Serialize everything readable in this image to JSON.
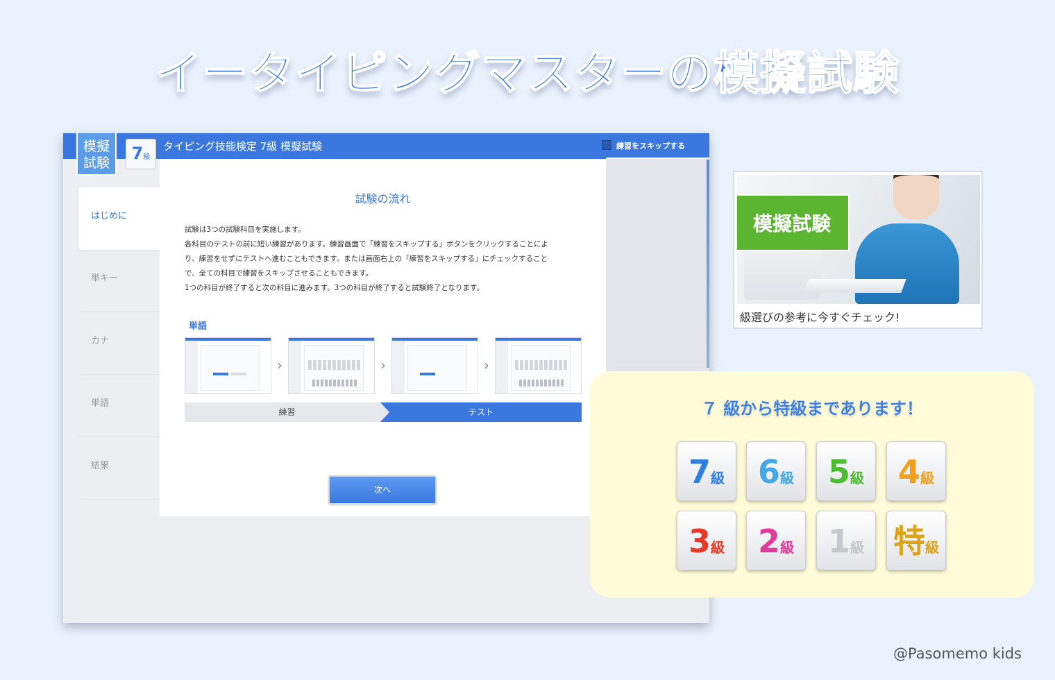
{
  "headline": "イータイピングマスターの模擬試験",
  "app": {
    "mode_badge": "模擬試験",
    "level_badge_num": "7",
    "level_badge_kyu": "級",
    "title": "タイピング技能検定 7級 模擬試験",
    "skip_label": "練習をスキップする",
    "sidebar": [
      "はじめに",
      "単キー",
      "カナ",
      "単語",
      "結果"
    ],
    "panel_title": "試験の流れ",
    "description": [
      "試験は3つの試験科目を実施します。",
      "各科目のテストの前に短い練習があります。練習画面で「練習をスキップする」ボタンをクリックすることによ",
      "り、練習をせずにテストへ進むこともできます。または画面右上の「練習をスキップする」にチェックすること",
      "で、全ての科目で練習をスキップさせることもできます。",
      "1つの科目が終了すると次の科目に進みます。3つの科目が終了すると試験終了となります。"
    ],
    "section_label": "単語",
    "chevron": "›",
    "flow_steps": [
      "練習",
      "テスト"
    ],
    "next_button": "次へ"
  },
  "promo": {
    "tag": "模擬試験",
    "caption": "級選びの参考に今すぐチェック!"
  },
  "levels": {
    "title": "７ 級から特級まであります！",
    "kyu_char": "級",
    "items": [
      {
        "num": "7",
        "color": "#2f7fe0"
      },
      {
        "num": "6",
        "color": "#45a6e8"
      },
      {
        "num": "5",
        "color": "#4cbc34"
      },
      {
        "num": "4",
        "color": "#f0a020"
      },
      {
        "num": "3",
        "color": "#e83a2a"
      },
      {
        "num": "2",
        "color": "#e03c9c"
      },
      {
        "num": "1",
        "color": "#c4c7cc"
      },
      {
        "num": "特",
        "color": "#d9a418"
      }
    ]
  },
  "credit": "@Pasomemo kids"
}
